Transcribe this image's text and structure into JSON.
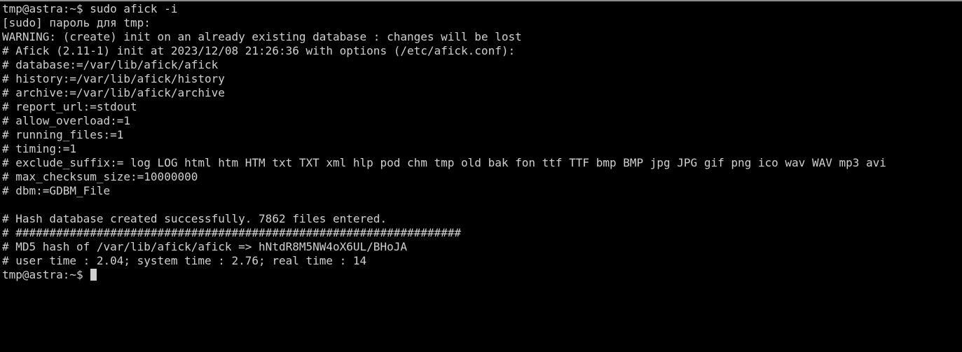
{
  "terminal": {
    "lines": [
      "tmp@astra:~$ sudo afick -i",
      "[sudo] пароль для tmp:",
      "WARNING: (create) init on an already existing database : changes will be lost",
      "# Afick (2.11-1) init at 2023/12/08 21:26:36 with options (/etc/afick.conf):",
      "# database:=/var/lib/afick/afick",
      "# history:=/var/lib/afick/history",
      "# archive:=/var/lib/afick/archive",
      "# report_url:=stdout",
      "# allow_overload:=1",
      "# running_files:=1",
      "# timing:=1",
      "# exclude_suffix:= log LOG html htm HTM txt TXT xml hlp pod chm tmp old bak fon ttf TTF bmp BMP jpg JPG gif png ico wav WAV mp3 avi",
      "# max_checksum_size:=10000000",
      "# dbm:=GDBM_File",
      "",
      "# Hash database created successfully. 7862 files entered.",
      "# ##################################################################",
      "# MD5 hash of /var/lib/afick/afick => hNtdR8M5NW4oX6UL/BHoJA",
      "# user time : 2.04; system time : 2.76; real time : 14"
    ],
    "prompt": "tmp@astra:~$ "
  },
  "colors": {
    "background": "#000000",
    "foreground": "#d0d0d0"
  }
}
